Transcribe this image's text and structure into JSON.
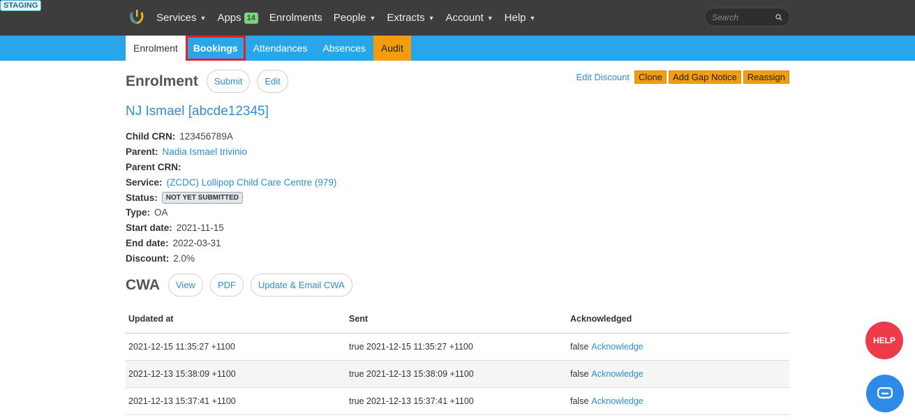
{
  "env_badge": "STAGING",
  "nav": {
    "items": [
      {
        "label": "Services",
        "caret": true
      },
      {
        "label": "Apps",
        "badge": "14"
      },
      {
        "label": "Enrolments"
      },
      {
        "label": "People",
        "caret": true
      },
      {
        "label": "Extracts",
        "caret": true
      },
      {
        "label": "Account",
        "caret": true
      },
      {
        "label": "Help",
        "caret": true
      }
    ],
    "search_placeholder": "Search"
  },
  "tabs": [
    "Enrolment",
    "Bookings",
    "Attendances",
    "Absences",
    "Audit"
  ],
  "enrolment": {
    "title": "Enrolment",
    "submit_label": "Submit",
    "edit_label": "Edit",
    "edit_discount_label": "Edit Discount",
    "clone_label": "Clone",
    "gap_notice_label": "Add Gap Notice",
    "reassign_label": "Reassign",
    "child_name": "NJ Ismael [abcde12345]"
  },
  "details": {
    "child_crn_label": "Child CRN:",
    "child_crn": "123456789A",
    "parent_label": "Parent:",
    "parent": "Nadia Ismael trivinio",
    "parent_crn_label": "Parent CRN:",
    "service_label": "Service:",
    "service": "(ZCDC) Lollipop Child Care Centre (979)",
    "status_label": "Status:",
    "status": "NOT YET SUBMITTED",
    "type_label": "Type:",
    "type": "OA",
    "start_label": "Start date:",
    "start": "2021-11-15",
    "end_label": "End date:",
    "end": "2022-03-31",
    "discount_label": "Discount:",
    "discount": "2.0%"
  },
  "cwa": {
    "title": "CWA",
    "view_label": "View",
    "pdf_label": "PDF",
    "update_label": "Update & Email CWA",
    "columns": [
      "Updated at",
      "Sent",
      "Acknowledged"
    ],
    "rows": [
      {
        "updated": "2021-12-15 11:35:27 +1100",
        "sent": "true 2021-12-15 11:35:27 +1100",
        "ack": "false",
        "ack_link": "Acknowledge"
      },
      {
        "updated": "2021-12-13 15:38:09 +1100",
        "sent": "true 2021-12-13 15:38:09 +1100",
        "ack": "false",
        "ack_link": "Acknowledge"
      },
      {
        "updated": "2021-12-13 15:37:41 +1100",
        "sent": "true 2021-12-13 15:37:41 +1100",
        "ack": "false",
        "ack_link": "Acknowledge"
      }
    ]
  },
  "help_label": "HELP",
  "colors": {
    "topbar": "#3d3d3d",
    "subnav": "#28a6e9",
    "accent": "#2e8fd0",
    "audit": "#f39c0e",
    "help": "#ee3b4a"
  }
}
